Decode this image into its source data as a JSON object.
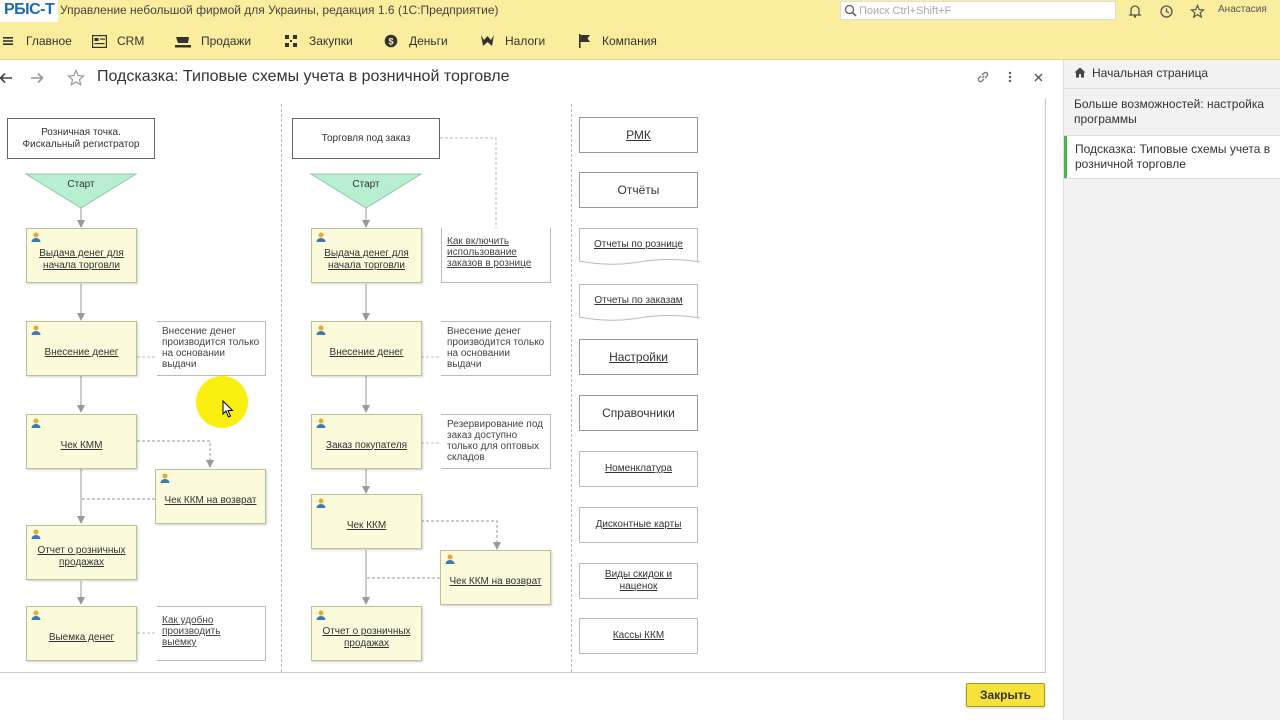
{
  "titlebar": {
    "logo": "РБIC-T",
    "app_title": "Управление небольшой фирмой для Украины, редакция 1.6  (1С:Предприятие)",
    "search_placeholder": "Поиск Ctrl+Shift+F",
    "user": "Анастасия"
  },
  "sections": [
    {
      "label": "Главное",
      "icon": "menu-icon"
    },
    {
      "label": "CRM",
      "icon": "crm-icon"
    },
    {
      "label": "Продажи",
      "icon": "cart-icon"
    },
    {
      "label": "Закупки",
      "icon": "purchases-icon"
    },
    {
      "label": "Деньги",
      "icon": "money-icon"
    },
    {
      "label": "Налоги",
      "icon": "taxes-icon"
    },
    {
      "label": "Компания",
      "icon": "flag-icon"
    }
  ],
  "form": {
    "title": "Подсказка: Типовые схемы учета в розничной торговле"
  },
  "col1": {
    "header": "Розничная точка.\nФискальный регистратор",
    "start": "Старт",
    "boxes": [
      "Выдача денег для начала торговли",
      "Внесение денег",
      "Чек КММ",
      "Чек ККМ на возврат",
      "Отчет о розничных продажах",
      "Выемка денег"
    ],
    "notes": [
      "Внесение денег производится только на основании выдачи",
      "Как удобно производить выемку"
    ]
  },
  "col2": {
    "header": "Торговля под заказ",
    "start": "Старт",
    "boxes": [
      "Выдача денег для начала торговли",
      "Внесение денег",
      "Заказ покупателя",
      "Чек ККМ",
      "Чек ККМ на возврат",
      "Отчет о розничных продажах"
    ],
    "notes": [
      "Как включить использование заказов в рознице",
      "Внесение денег производится только на основании выдачи",
      "Резервирование под заказ доступно только для оптовых складов"
    ]
  },
  "col3": [
    {
      "label": "РМК",
      "link": true,
      "small": false
    },
    {
      "label": "Отчёты",
      "link": false,
      "small": false
    },
    {
      "label": "Отчеты по рознице",
      "link": true,
      "small": true
    },
    {
      "label": "Отчеты по заказам",
      "link": true,
      "small": true
    },
    {
      "label": "Настройки",
      "link": true,
      "small": false
    },
    {
      "label": "Справочники",
      "link": false,
      "small": false
    },
    {
      "label": "Номенклатура",
      "link": true,
      "small": true
    },
    {
      "label": "Дисконтные карты",
      "link": true,
      "small": true
    },
    {
      "label": "Виды скидок и наценок",
      "link": true,
      "small": true
    },
    {
      "label": "Кассы ККМ",
      "link": true,
      "small": true
    }
  ],
  "right_panel": {
    "items": [
      "Начальная страница",
      "Больше возможностей: настройка программы",
      "Подсказка: Типовые схемы учета в розничной торговле"
    ]
  },
  "footer": {
    "close_label": "Закрыть"
  },
  "colors": {
    "bar": "#fbed9e",
    "start": "#b7efd0",
    "box": "#fbfbdb",
    "close": "#f7e23c",
    "accent": "#4caf50"
  }
}
